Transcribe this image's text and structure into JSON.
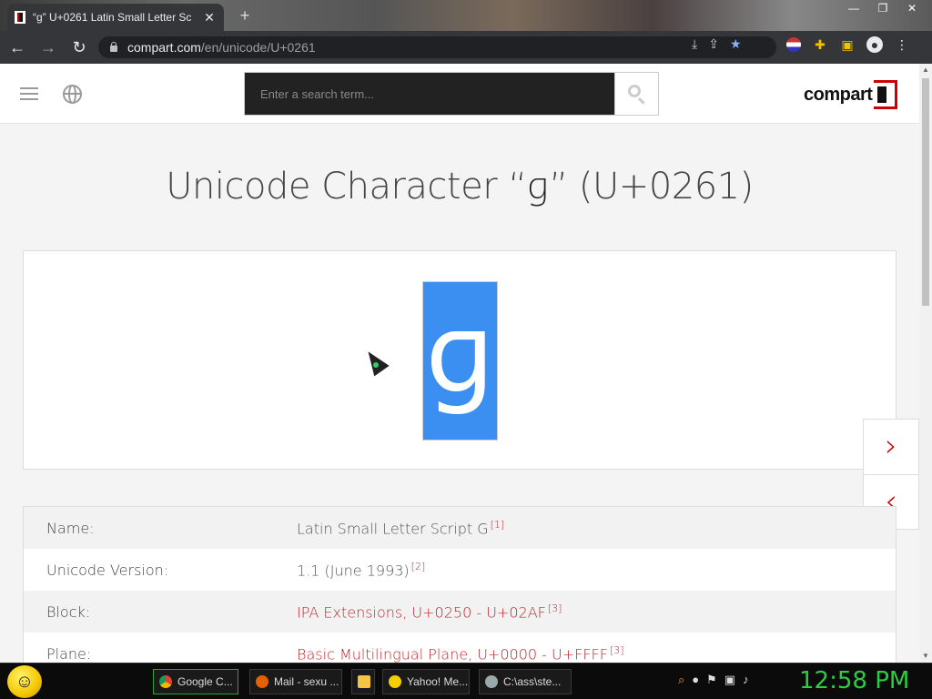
{
  "browser": {
    "tab_title": "“ɡ” U+0261 Latin Small Letter Sc",
    "tab_close": "✕",
    "new_tab": "+",
    "window_buttons": [
      "—",
      "❐",
      "✕"
    ],
    "url_host": "compart.com",
    "url_path": "/en/unicode/U+0261",
    "nav": {
      "back": "←",
      "forward": "→",
      "reload": "↻"
    }
  },
  "header": {
    "search_placeholder": "Enter a search term...",
    "logo_text": "compart"
  },
  "page": {
    "title_prefix": "Unicode Character “",
    "title_glyph": "ɡ",
    "title_suffix": "” (U+0261)",
    "glyph": "ɡ",
    "next_arrow": "›",
    "prev_arrow": "‹"
  },
  "properties": [
    {
      "key": "Name:",
      "value": "Latin Small Letter Script G",
      "ref": "[1]",
      "link": false
    },
    {
      "key": "Unicode Version:",
      "value": "1.1 (June 1993)",
      "ref": "[2]",
      "link": false
    },
    {
      "key": "Block:",
      "value": "IPA Extensions, U+0250 - U+02AF",
      "ref": "[3]",
      "link": true
    },
    {
      "key": "Plane:",
      "value": "Basic Multilingual Plane, U+0000 - U+FFFF",
      "ref": "[3]",
      "link": true
    }
  ],
  "taskbar": {
    "tasks": [
      "Google C...",
      "Mail - sexu ...",
      "",
      "Yahoo! Me...",
      "C:\\ass\\ste..."
    ],
    "clock": "12:58 PM"
  },
  "colors": {
    "accent": "#c0262d",
    "selection": "#3b8ff0",
    "clock": "#2ecc40"
  }
}
